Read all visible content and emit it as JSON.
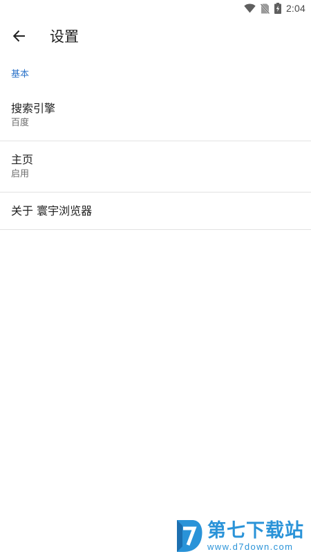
{
  "status_bar": {
    "time": "2:04",
    "icons": [
      "wifi-icon",
      "no-sim-icon",
      "battery-charging-icon"
    ]
  },
  "toolbar": {
    "back_icon": "arrow-back-icon",
    "title": "设置"
  },
  "section": {
    "header": "基本"
  },
  "preferences": [
    {
      "title": "搜索引擎",
      "summary": "百度"
    },
    {
      "title": "主页",
      "summary": "启用"
    },
    {
      "title": "关于 寰宇浏览器"
    }
  ],
  "watermark": {
    "title": "第七下载站",
    "url": "www.d7down.com",
    "color": "#2a93d8"
  },
  "colors": {
    "accent": "#2b73c9",
    "divider": "#e2e2e2",
    "text_primary": "#212121",
    "text_secondary": "#6b6b6b"
  }
}
